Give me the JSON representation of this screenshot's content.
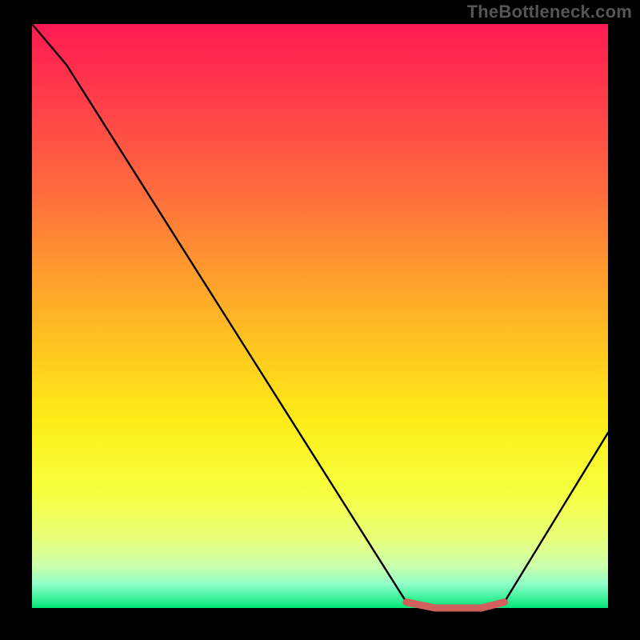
{
  "watermark": "TheBottleneck.com",
  "chart_data": {
    "type": "line",
    "title": "",
    "xlabel": "",
    "ylabel": "",
    "xlim": [
      0,
      100
    ],
    "ylim": [
      0,
      100
    ],
    "series": [
      {
        "name": "bottleneck-curve",
        "x": [
          0,
          6,
          65,
          70,
          78,
          82,
          100
        ],
        "values": [
          100,
          93,
          1,
          0,
          0,
          1,
          30
        ]
      }
    ],
    "highlight": {
      "name": "flat-minimum",
      "color": "#d1605d",
      "x": [
        65,
        70,
        78,
        82
      ],
      "values": [
        1,
        0,
        0,
        1
      ]
    },
    "gradient_stops": [
      {
        "pos": 0,
        "color": "#ff1a52"
      },
      {
        "pos": 12,
        "color": "#ff3b4a"
      },
      {
        "pos": 28,
        "color": "#ff6a3e"
      },
      {
        "pos": 42,
        "color": "#ff9a2e"
      },
      {
        "pos": 56,
        "color": "#ffc81f"
      },
      {
        "pos": 68,
        "color": "#fded18"
      },
      {
        "pos": 80,
        "color": "#f6ff3e"
      },
      {
        "pos": 88,
        "color": "#e9ff7a"
      },
      {
        "pos": 93,
        "color": "#c9ffae"
      },
      {
        "pos": 96,
        "color": "#8cffc9"
      },
      {
        "pos": 100,
        "color": "#00e676"
      }
    ]
  }
}
